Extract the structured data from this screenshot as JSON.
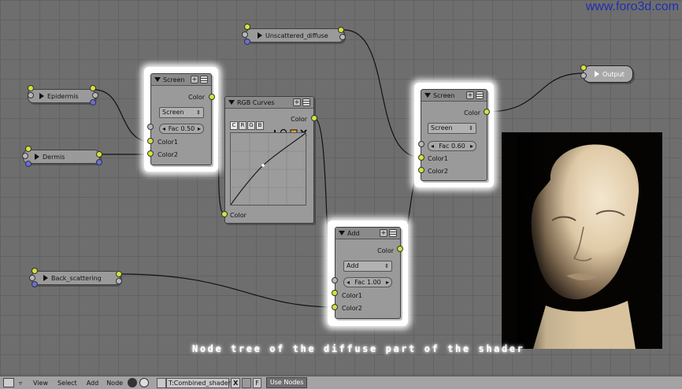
{
  "watermark": "www.foro3d.com",
  "caption": "Node tree of the diffuse part of the shader",
  "nodes": {
    "epidermis": {
      "label": "Epidermis"
    },
    "dermis": {
      "label": "Dermis"
    },
    "back_scattering": {
      "label": "Back_scattering"
    },
    "unscattered_diffuse": {
      "label": "Unscattered_diffuse"
    },
    "output": {
      "label": "Output"
    },
    "screen1": {
      "title": "Screen",
      "out": "Color",
      "mode": "Screen",
      "fac": "Fac 0.50",
      "in1": "Color1",
      "in2": "Color2"
    },
    "rgb_curves": {
      "title": "RGB Curves",
      "out": "Color",
      "in": "Color",
      "tabs": [
        "C",
        "R",
        "G",
        "B"
      ]
    },
    "add": {
      "title": "Add",
      "out": "Color",
      "mode": "Add",
      "fac": "Fac 1.00",
      "in1": "Color1",
      "in2": "Color2"
    },
    "screen2": {
      "title": "Screen",
      "out": "Color",
      "mode": "Screen",
      "fac": "Fac 0.60",
      "in1": "Color1",
      "in2": "Color2"
    }
  },
  "header_buttons": {
    "plus": "+"
  },
  "arrows": {
    "left": "◂",
    "right": "▸",
    "updown": "⇕"
  },
  "statusbar": {
    "menus": [
      "View",
      "Select",
      "Add",
      "Node"
    ],
    "material_name": "T:Combined_shaders",
    "x_btn": "X",
    "f_btn": "F",
    "use_nodes": "Use Nodes"
  },
  "icons": {
    "collapse": "triangle-down-icon",
    "expand": "triangle-right-icon",
    "zoom": "magnifier-icon",
    "clip": "clipping-icon",
    "reset": "x-icon"
  },
  "colors": {
    "socket_color": "#d6e23a",
    "socket_vector": "#6c6cd8",
    "socket_value": "#b8b8b8",
    "watermark": "#1d2fb0"
  }
}
